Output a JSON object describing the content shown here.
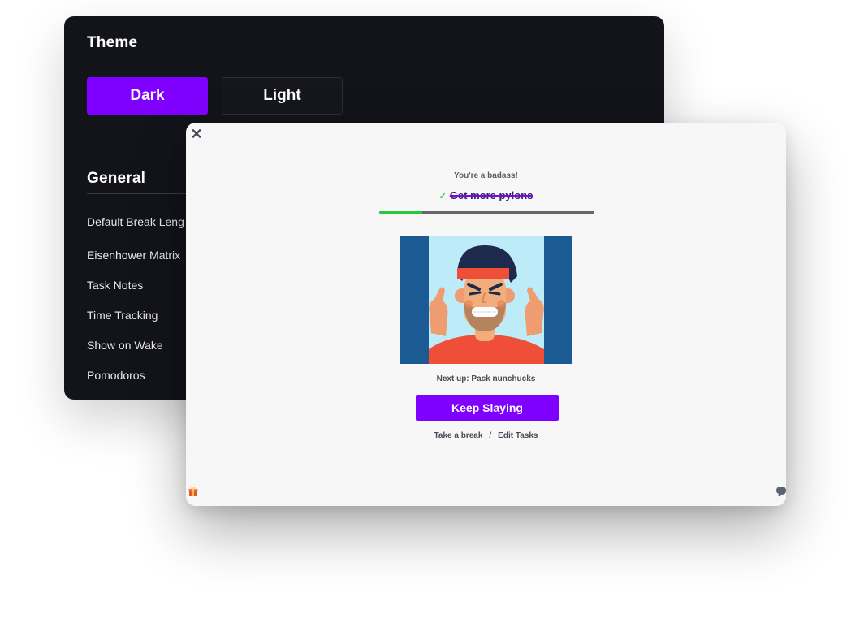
{
  "settings": {
    "theme_title": "Theme",
    "theme_options": [
      {
        "label": "Dark",
        "selected": true
      },
      {
        "label": "Light",
        "selected": false
      }
    ],
    "general_title": "General",
    "general_items": [
      "Default Break Leng",
      "Eisenhower Matrix",
      "Task Notes",
      "Time Tracking",
      "Show on Wake",
      "Pomodoros"
    ]
  },
  "modal": {
    "close_icon": "close-icon",
    "encouragement": "You're a badass!",
    "completed_task": "Get more pylons",
    "check_glyph": "✓",
    "progress_fraction": 0.2,
    "illustration": "angry-man-illustration",
    "next_up": "Next up: Pack nunchucks",
    "primary_button": "Keep Slaying",
    "secondary_links": [
      "Take a break",
      "Edit Tasks"
    ],
    "link_separator": "/",
    "footer_left_icon": "gift-icon",
    "footer_right_icon": "chat-bubble-icon"
  },
  "colors": {
    "accent": "#8000ff",
    "progress": "#23c940",
    "dark_bg": "#131419",
    "modal_bg": "#f7f7f8"
  }
}
